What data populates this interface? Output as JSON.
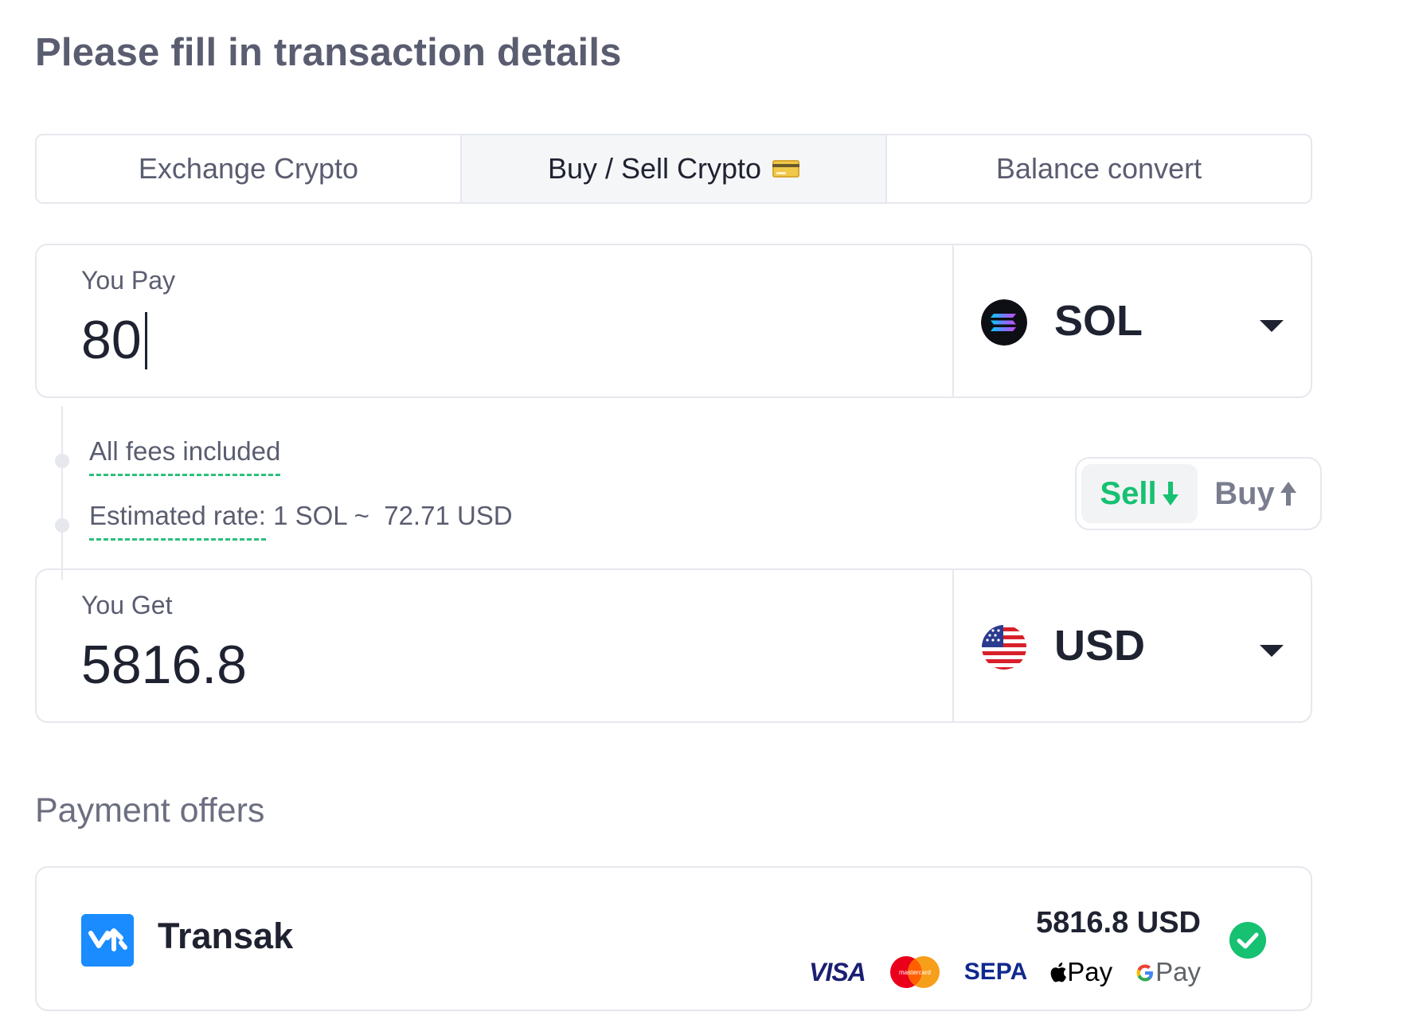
{
  "title": "Please fill in transaction details",
  "tabs": [
    {
      "label": "Exchange Crypto",
      "active": false
    },
    {
      "label": "Buy / Sell Crypto",
      "active": true,
      "icon": "credit-card-icon"
    },
    {
      "label": "Balance convert",
      "active": false
    }
  ],
  "pay": {
    "label": "You Pay",
    "value": "80",
    "currency": "SOL",
    "currency_icon": "solana-icon"
  },
  "info": {
    "fees": "All fees included",
    "rate_label": "Estimated rate:",
    "rate_value": "1 SOL ~  72.71 USD"
  },
  "mode_toggle": {
    "sell_label": "Sell",
    "buy_label": "Buy",
    "selected": "Sell",
    "sell_color": "#16c172"
  },
  "get": {
    "label": "You Get",
    "value": "5816.8",
    "currency": "USD",
    "currency_icon": "us-flag-icon"
  },
  "offers": {
    "title": "Payment offers",
    "items": [
      {
        "provider": "Transak",
        "provider_icon": "transak-logo-icon",
        "amount": "5816.8 USD",
        "selected": true,
        "methods": {
          "visa": "VISA",
          "mastercard": "mastercard",
          "sepa": "SEPA",
          "apple_pay": "Pay",
          "google_pay": "Pay"
        }
      }
    ]
  }
}
